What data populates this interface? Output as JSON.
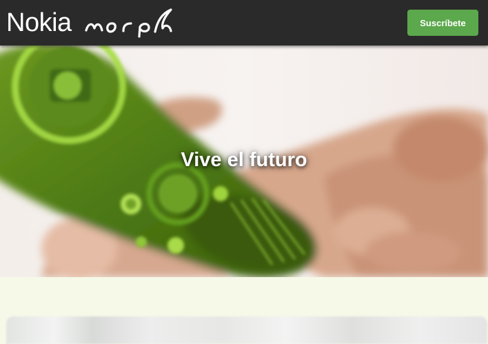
{
  "header": {
    "brand_name": "Nokia",
    "brand_script": "morph",
    "subscribe_label": "Suscríbete"
  },
  "hero": {
    "title": "Vive el futuro",
    "image": "hand-holding-green-nokia-morph-phone"
  },
  "colors": {
    "topbar": "#2a2a2a",
    "button": "#5ca84c",
    "page_background": "#f6f9e8"
  }
}
